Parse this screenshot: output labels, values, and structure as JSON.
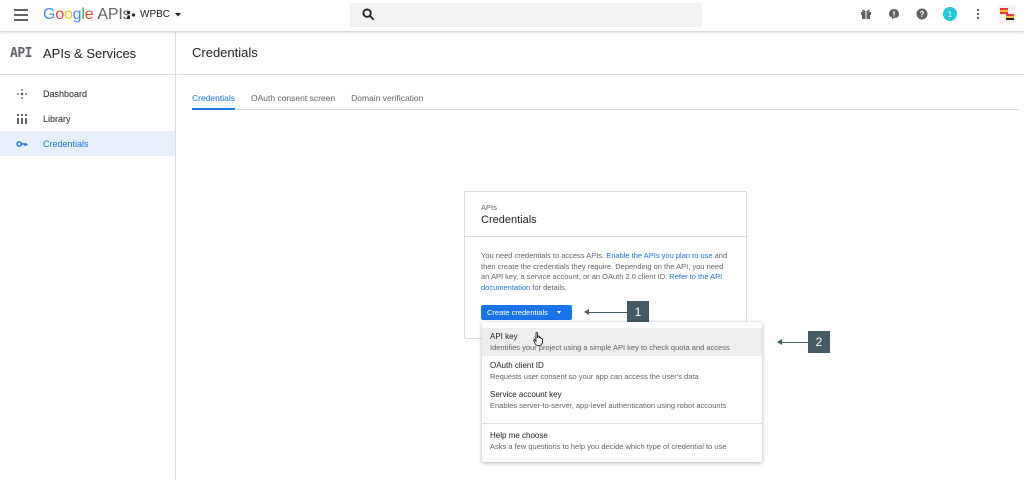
{
  "topbar": {
    "logo_google": [
      "G",
      "o",
      "o",
      "g",
      "l",
      "e"
    ],
    "logo_apis": "APIs",
    "project_name": "WPBC",
    "notification_count": "1",
    "icons": [
      "gift-icon",
      "feedback-icon",
      "help-icon",
      "notifications-icon",
      "more-vert-icon",
      "avatar"
    ]
  },
  "sidebar": {
    "brand_mark": "API",
    "title": "APIs & Services",
    "items": [
      {
        "label": "Dashboard",
        "icon": "dashboard-icon"
      },
      {
        "label": "Library",
        "icon": "library-icon"
      },
      {
        "label": "Credentials",
        "icon": "key-icon",
        "active": true
      }
    ]
  },
  "main": {
    "title": "Credentials",
    "tabs": [
      {
        "label": "Credentials",
        "active": true
      },
      {
        "label": "OAuth consent screen"
      },
      {
        "label": "Domain verification"
      }
    ]
  },
  "card": {
    "eyebrow": "APIs",
    "title": "Credentials",
    "text_1": "You need credentials to access APIs. ",
    "link_1": "Enable the APIs you plan to use",
    "text_2": " and then create the credentials they require. Depending on the API, you need an API key, a service account, or an OAuth 2.0 client ID. ",
    "link_2": "Refer to the API documentation",
    "text_3": " for details.",
    "button_label": "Create credentials"
  },
  "menu": {
    "items": [
      {
        "label": "API key",
        "desc": "Identifies your project using a simple API key to check quota and access"
      },
      {
        "label": "OAuth client ID",
        "desc": "Requests user consent so your app can access the user's data"
      },
      {
        "label": "Service account key",
        "desc": "Enables server-to-server, app-level authentication using robot accounts"
      },
      {
        "label": "Help me choose",
        "desc": "Asks a few questions to help you decide which type of credential to use"
      }
    ]
  },
  "callouts": [
    "1",
    "2"
  ],
  "colors": {
    "accent": "#1a73e8",
    "callout": "#455a64",
    "active_bg": "#e8f0fe"
  }
}
